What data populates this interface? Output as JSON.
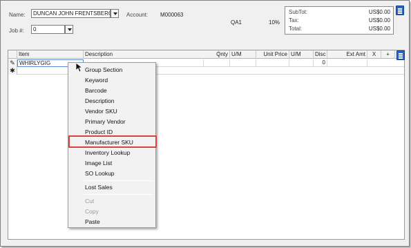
{
  "header": {
    "name_label": "Name:",
    "name_value": "DUNCAN JOHN FRENTSBERG",
    "account_label": "Account:",
    "account_value": "M000063",
    "job_label": "Job #:",
    "job_value": "0",
    "code_value": "QA1",
    "percent_value": "10%"
  },
  "totals": {
    "subtotal_label": "SubTot:",
    "subtotal_value": "US$0.00",
    "tax_label": "Tax:",
    "tax_value": "US$0.00",
    "total_label": "Total:",
    "total_value": "US$0.00"
  },
  "grid": {
    "columns": [
      "Item",
      "Description",
      "Qnty",
      "U/M",
      "Unit Price",
      "U/M",
      "Disc",
      "Ext Amt",
      "X",
      "+"
    ],
    "rows": [
      {
        "item": "WHIRLYGIG",
        "disc": "0"
      }
    ]
  },
  "context_menu": {
    "items": [
      "Group Section",
      "Keyword",
      "Barcode",
      "Description",
      "Vendor SKU",
      "Primary Vendor",
      "Product ID",
      "Manufacturer SKU",
      "Inventory Lookup",
      "Image List",
      "SO Lookup",
      "Lost Sales",
      "Cut",
      "Copy",
      "Paste"
    ],
    "highlighted": "Manufacturer SKU"
  },
  "colors": {
    "highlight_border": "#d9433f",
    "menu_button": "#2a66c8"
  }
}
